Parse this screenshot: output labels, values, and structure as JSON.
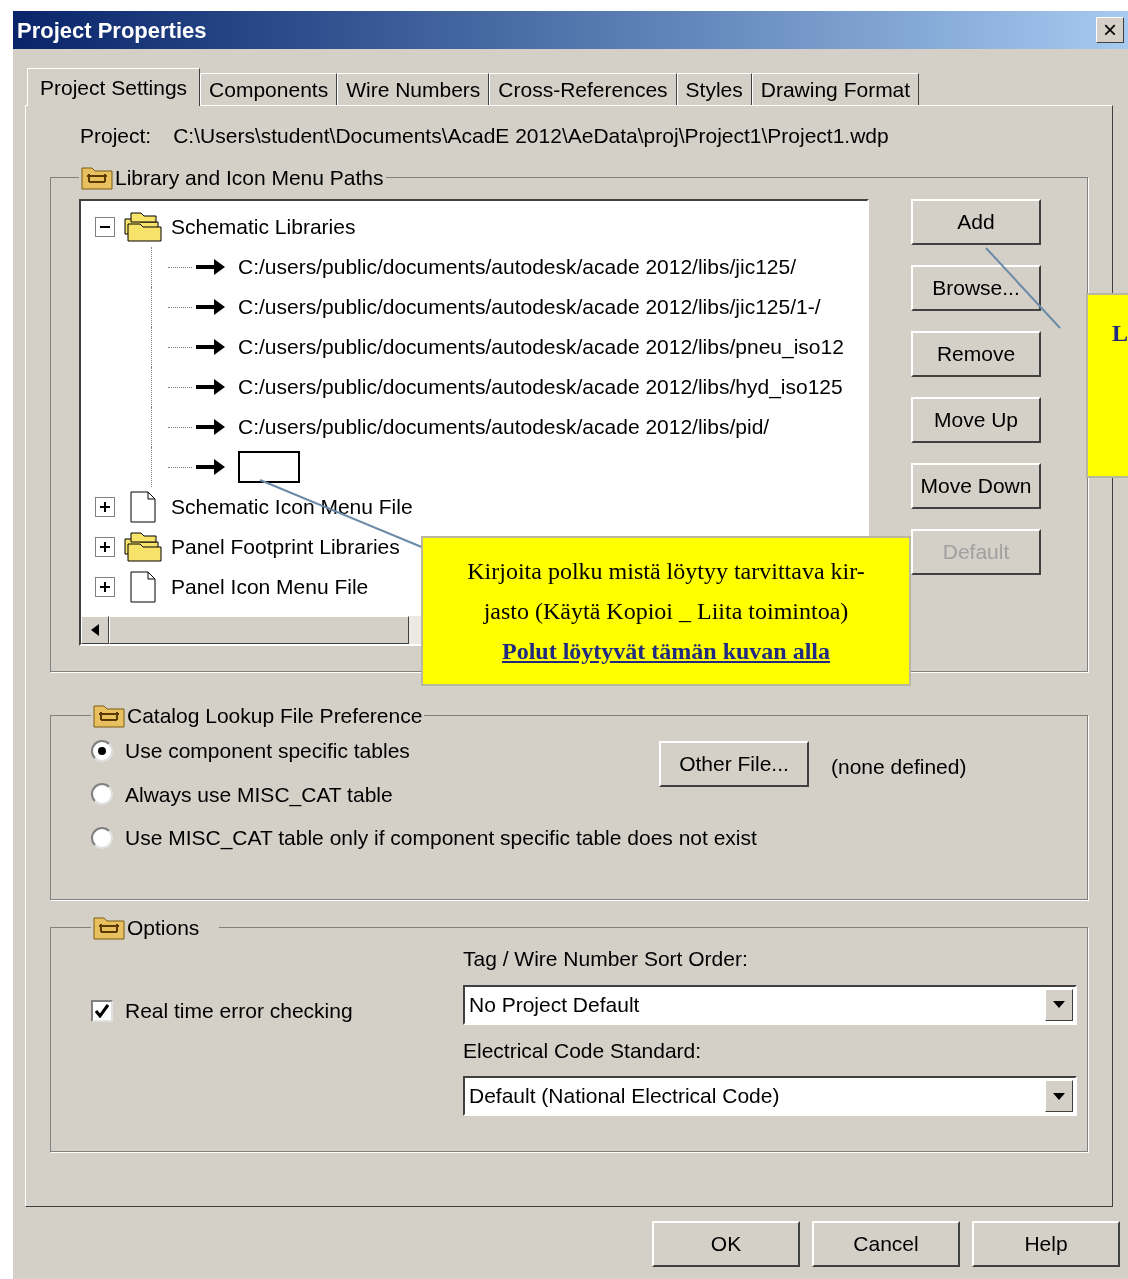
{
  "window": {
    "title": "Project Properties",
    "close": "×"
  },
  "tabs": [
    {
      "label": "Project Settings",
      "selected": true
    },
    {
      "label": "Components",
      "selected": false
    },
    {
      "label": "Wire Numbers",
      "selected": false
    },
    {
      "label": "Cross-References",
      "selected": false
    },
    {
      "label": "Styles",
      "selected": false
    },
    {
      "label": "Drawing Format",
      "selected": false
    }
  ],
  "project": {
    "label": "Project:",
    "path": "C:\\Users\\student\\Documents\\AcadE 2012\\AeData\\proj\\Project1\\Project1.wdp"
  },
  "library_paths": {
    "title": "Library and Icon Menu Paths",
    "tree": [
      {
        "label": "Schematic Libraries",
        "kind": "folder",
        "expanded": true,
        "children": [
          {
            "kind": "path",
            "label": "C:/users/public/documents/autodesk/acade 2012/libs/jic125/"
          },
          {
            "kind": "path",
            "label": "C:/users/public/documents/autodesk/acade 2012/libs/jic125/1-/"
          },
          {
            "kind": "path",
            "label": "C:/users/public/documents/autodesk/acade 2012/libs/pneu_iso12"
          },
          {
            "kind": "path",
            "label": "C:/users/public/documents/autodesk/acade 2012/libs/hyd_iso125"
          },
          {
            "kind": "path",
            "label": "C:/users/public/documents/autodesk/acade 2012/libs/pid/"
          },
          {
            "kind": "edit"
          }
        ]
      },
      {
        "label": "Schematic Icon Menu File",
        "kind": "file",
        "expanded": false
      },
      {
        "label": "Panel Footprint Libraries",
        "kind": "folder",
        "expanded": false
      },
      {
        "label": "Panel Icon Menu File",
        "kind": "file",
        "expanded": false
      }
    ],
    "buttons": [
      {
        "label": "Add",
        "disabled": false
      },
      {
        "label": "Browse...",
        "disabled": false
      },
      {
        "label": "Remove",
        "disabled": false
      },
      {
        "label": "Move Up",
        "disabled": false
      },
      {
        "label": "Move Down",
        "disabled": false
      },
      {
        "label": "Default",
        "disabled": true
      }
    ]
  },
  "callouts": [
    {
      "kind": "main",
      "lines": [
        "Kirjoita polku mistä löytyy tarvittava kir-",
        "jasto (Käytä Kopioi _ Liita toimintoa)"
      ],
      "link": "Polut löytyvät tämän kuvan alla"
    },
    {
      "kind": "side",
      "lines": [
        "L"
      ]
    }
  ],
  "catalog": {
    "title": "Catalog Lookup File Preference",
    "options": [
      {
        "label": "Use component specific tables",
        "selected": true
      },
      {
        "label": "Always use MISC_CAT table",
        "selected": false
      },
      {
        "label": "Use MISC_CAT table only if component specific table does not exist",
        "selected": false
      }
    ],
    "other_file_button": "Other File...",
    "note": "(none defined)"
  },
  "options": {
    "title": "Options",
    "checkbox": {
      "label": "Real time error checking",
      "checked": true
    },
    "dropdowns": [
      {
        "label": "Tag / Wire Number Sort Order:",
        "value": "No Project Default"
      },
      {
        "label": "Electrical Code Standard:",
        "value": "Default (National Electrical Code)"
      }
    ]
  },
  "footer_buttons": [
    "OK",
    "Cancel",
    "Help"
  ]
}
